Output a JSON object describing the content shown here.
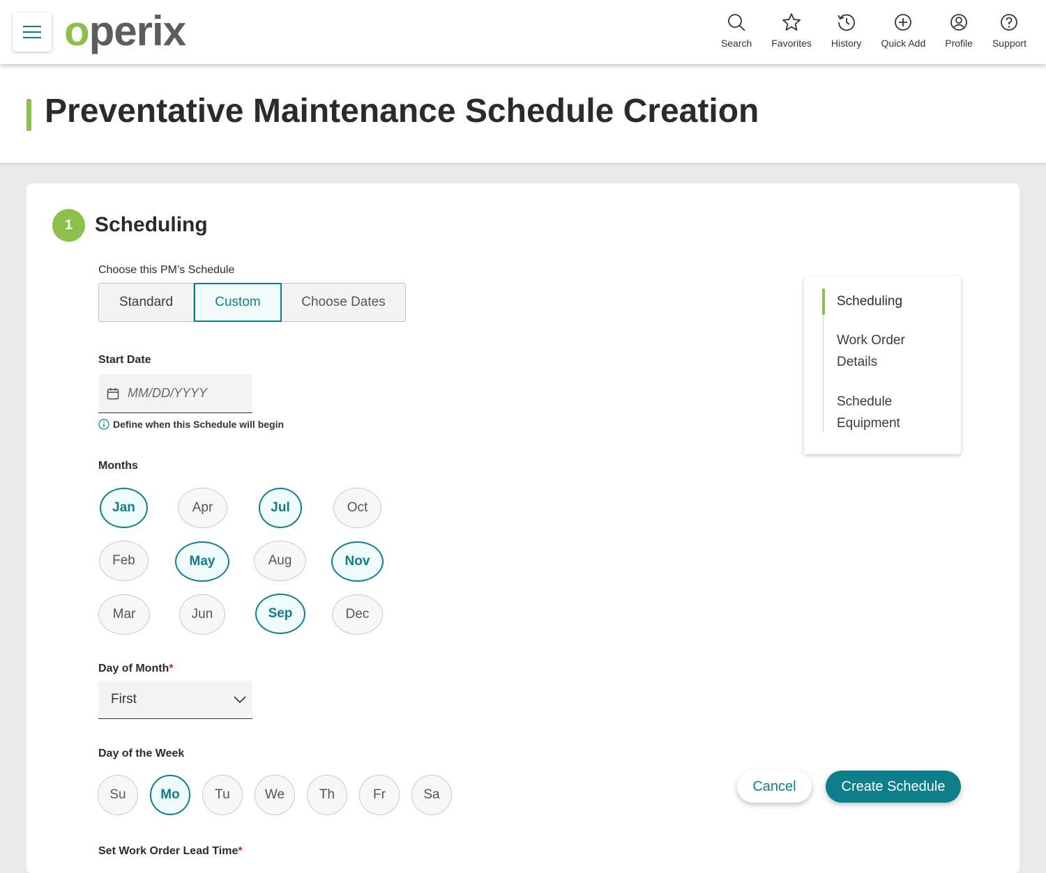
{
  "header": {
    "logo_o": "o",
    "logo_rest": "perix",
    "nav": [
      {
        "label": "Search",
        "icon": "search-icon"
      },
      {
        "label": "Favorites",
        "icon": "star-icon"
      },
      {
        "label": "History",
        "icon": "history-icon"
      },
      {
        "label": "Quick Add",
        "icon": "plus-circle-icon"
      },
      {
        "label": "Profile",
        "icon": "user-icon"
      },
      {
        "label": "Support",
        "icon": "help-icon"
      }
    ]
  },
  "page": {
    "title": "Preventative Maintenance Schedule Creation"
  },
  "section": {
    "number": "1",
    "title": "Scheduling"
  },
  "schedule_type": {
    "label": "Choose this PM’s Schedule",
    "options": [
      "Standard",
      "Custom",
      "Choose Dates"
    ],
    "selected": "Custom"
  },
  "start_date": {
    "label": "Start Date",
    "placeholder": "MM/DD/YYYY",
    "value": "",
    "hint": "Define when this Schedule will begin"
  },
  "months": {
    "label": "Months",
    "items": [
      {
        "label": "Jan",
        "selected": true
      },
      {
        "label": "Feb",
        "selected": false
      },
      {
        "label": "Mar",
        "selected": false
      },
      {
        "label": "Apr",
        "selected": false
      },
      {
        "label": "May",
        "selected": true
      },
      {
        "label": "Jun",
        "selected": false
      },
      {
        "label": "Jul",
        "selected": true
      },
      {
        "label": "Aug",
        "selected": false
      },
      {
        "label": "Sep",
        "selected": true
      },
      {
        "label": "Oct",
        "selected": false
      },
      {
        "label": "Nov",
        "selected": true
      },
      {
        "label": "Dec",
        "selected": false
      }
    ]
  },
  "day_of_month": {
    "label": "Day of Month",
    "required_mark": "*",
    "value": "First"
  },
  "day_of_week": {
    "label": "Day of the Week",
    "items": [
      {
        "label": "Su",
        "selected": false
      },
      {
        "label": "Mo",
        "selected": true
      },
      {
        "label": "Tu",
        "selected": false
      },
      {
        "label": "We",
        "selected": false
      },
      {
        "label": "Th",
        "selected": false
      },
      {
        "label": "Fr",
        "selected": false
      },
      {
        "label": "Sa",
        "selected": false
      }
    ]
  },
  "lead_time": {
    "label": "Set Work Order Lead Time",
    "required_mark": "*"
  },
  "stepper": {
    "items": [
      "Scheduling",
      "Work Order Details",
      "Schedule Equipment"
    ],
    "current": "Scheduling"
  },
  "actions": {
    "cancel": "Cancel",
    "create": "Create Schedule"
  },
  "colors": {
    "accent_green": "#8cc04a",
    "primary_teal": "#0e7f8a",
    "required_red": "#c0243c"
  }
}
